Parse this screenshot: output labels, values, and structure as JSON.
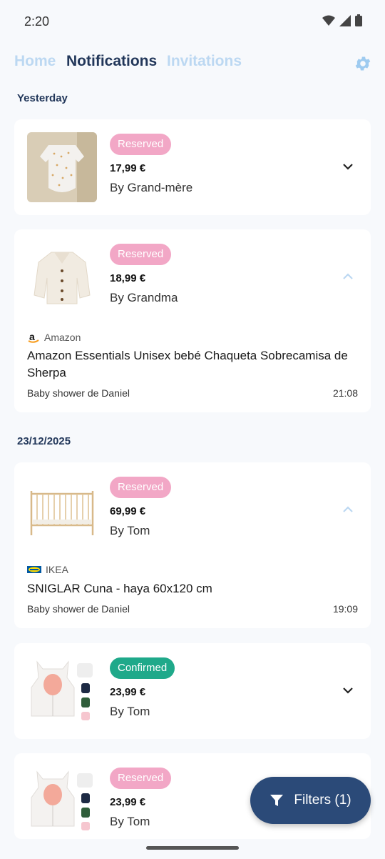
{
  "status_bar": {
    "time": "2:20"
  },
  "nav": {
    "home": "Home",
    "notifications": "Notifications",
    "invitations": "Invitations"
  },
  "sections": {
    "yesterday": "Yesterday",
    "date2": "23/12/2025"
  },
  "cards": [
    {
      "status": "Reserved",
      "price": "17,99 €",
      "by": "By Grand-mère"
    },
    {
      "status": "Reserved",
      "price": "18,99 €",
      "by": "By Grandma",
      "store": "Amazon",
      "title": "Amazon Essentials Unisex bebé Chaqueta Sobrecamisa de Sherpa",
      "event": "Baby shower de Daniel",
      "time": "21:08"
    },
    {
      "status": "Reserved",
      "price": "69,99 €",
      "by": "By Tom",
      "store": "IKEA",
      "title": "SNIGLAR Cuna - haya 60x120 cm",
      "event": "Baby shower de Daniel",
      "time": "19:09"
    },
    {
      "status": "Confirmed",
      "price": "23,99 €",
      "by": "By Tom"
    },
    {
      "status": "Reserved",
      "price": "23,99 €",
      "by": "By Tom"
    }
  ],
  "fab": {
    "label": "Filters (1)"
  },
  "colors": {
    "primary": "#22375a",
    "inactive_tab": "#bcd8f2",
    "reserved": "#f2a7c6",
    "confirmed": "#1fa98a",
    "fab": "#2b4a78"
  }
}
